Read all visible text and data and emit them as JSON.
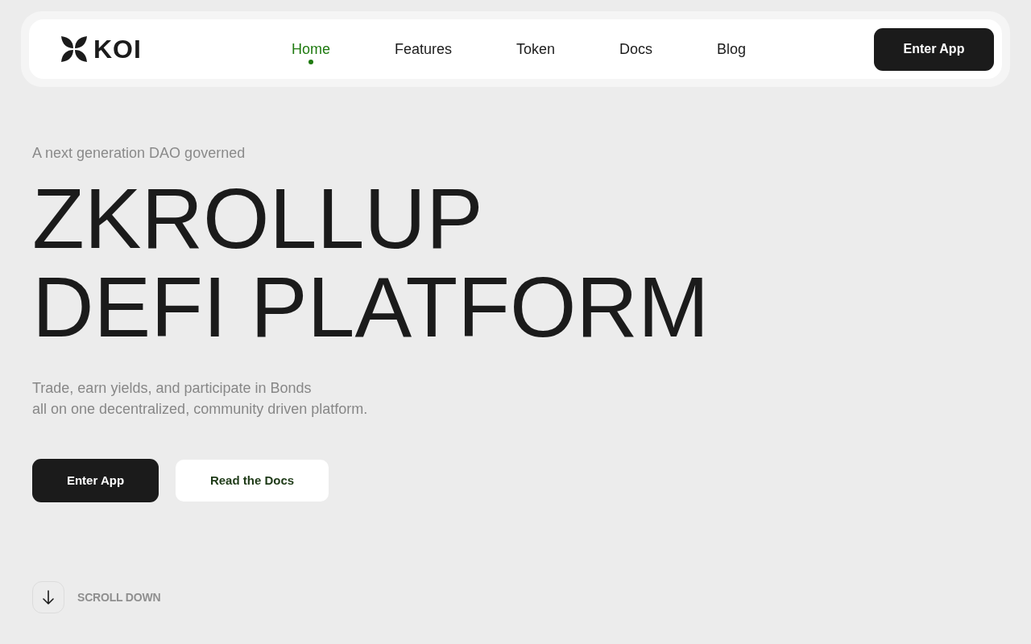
{
  "nav": {
    "logo": {
      "text": "KOI"
    },
    "links": [
      {
        "label": "Home",
        "selected": true
      },
      {
        "label": "Features",
        "selected": false
      },
      {
        "label": "Token",
        "selected": false
      },
      {
        "label": "Docs",
        "selected": false
      },
      {
        "label": "Blog",
        "selected": false
      }
    ],
    "cta": {
      "label": "Enter App"
    }
  },
  "hero": {
    "eyebrow": "A next generation DAO governed",
    "headline_lines": [
      "ZKROLLUP",
      "DEFI PLATFORM"
    ],
    "description_lines": [
      "Trade, earn yields, and participate in Bonds",
      "all on one decentralized, community driven platform."
    ],
    "buttons": [
      {
        "label": "Enter App",
        "kind": "primary"
      },
      {
        "label": "Read the Docs",
        "kind": "secondary"
      }
    ]
  },
  "scroll_hint": {
    "label": "SCROLL DOWN"
  }
}
